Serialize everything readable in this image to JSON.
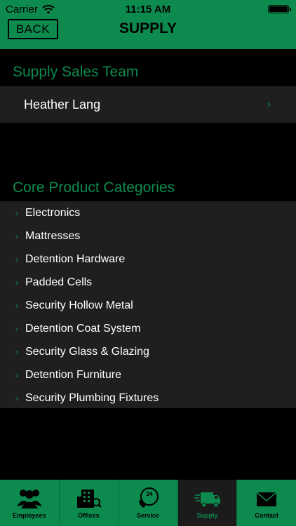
{
  "status_bar": {
    "carrier": "Carrier",
    "time": "11:15 AM"
  },
  "nav": {
    "back_label": "BACK",
    "title": "SUPPLY"
  },
  "sales_team": {
    "header": "Supply Sales Team",
    "members": [
      "Heather Lang"
    ]
  },
  "categories": {
    "header": "Core Product Categories",
    "items": [
      "Electronics",
      "Mattresses",
      "Detention Hardware",
      "Padded Cells",
      "Security Hollow Metal",
      "Detention Coat System",
      "Security Glass & Glazing",
      "Detention Furniture",
      "Security Plumbing Fixtures"
    ]
  },
  "tab_bar": {
    "tabs": [
      {
        "label": "Employees",
        "icon": "employees-icon",
        "active": false
      },
      {
        "label": "Offices",
        "icon": "offices-icon",
        "active": false
      },
      {
        "label": "Service",
        "icon": "service-icon",
        "active": false
      },
      {
        "label": "Supply",
        "icon": "supply-truck-icon",
        "active": true
      },
      {
        "label": "Contact",
        "icon": "contact-envelope-icon",
        "active": false
      }
    ]
  },
  "colors": {
    "accent": "#0d8a4e",
    "row_background": "#1f1f1f",
    "background": "#000000"
  }
}
